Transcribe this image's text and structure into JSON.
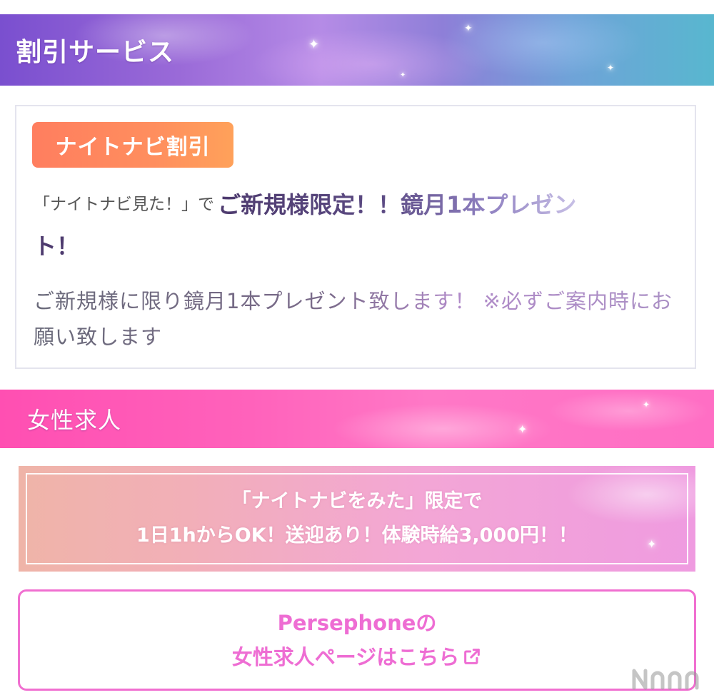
{
  "discount_section": {
    "title": "割引サービス",
    "badge": "ナイトナビ割引",
    "headline_quote": "「ナイトナビ見た！」で",
    "headline_main": "ご新規様限定！！鏡月1本プレゼン",
    "headline_wrap": "ト！",
    "description": "ご新規様に限り鏡月1本プレゼント致します！ ※必ずご案内時にお願い致します"
  },
  "women_section": {
    "title": "女性求人",
    "banner_line1": "「ナイトナビをみた」限定で",
    "banner_line2": "1日1hからOK！送迎あり！体験時給3,000円！！",
    "link_line1": "Persephoneの",
    "link_line2": "女性求人ページはこちら",
    "link_icon": "external-link-icon"
  },
  "watermark_icon": "site-logo-watermark",
  "colors": {
    "discount_header_start": "#7a4fcf",
    "discount_header_end": "#58b7cf",
    "women_header": "#ff5fb9",
    "badge": "#ff8a5e",
    "link_accent": "#ee6dd3"
  }
}
